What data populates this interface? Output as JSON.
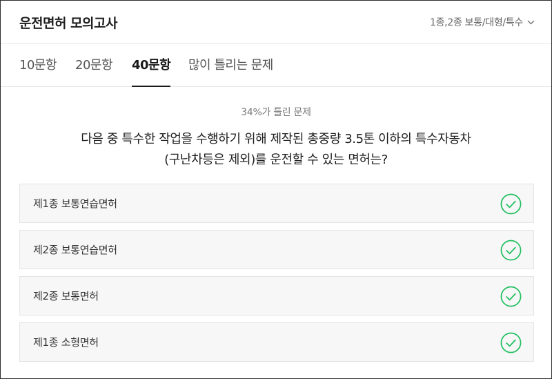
{
  "header": {
    "title": "운전면허 모의고사",
    "license_type": "1종,2종 보통/대형/특수"
  },
  "tabs": [
    {
      "label": "10문항",
      "active": false
    },
    {
      "label": "20문항",
      "active": false
    },
    {
      "label": "40문항",
      "active": true
    },
    {
      "label": "많이 틀리는 문제",
      "active": false
    }
  ],
  "question": {
    "stat": "34%가 틀린 문제",
    "line1": "다음 중 특수한 작업을 수행하기 위해 제작된 총중량 3.5톤 이하의 특수자동차",
    "line2": "(구난차등은 제외)를 운전할 수 있는 면허는?"
  },
  "options": [
    {
      "label": "제1종 보통연습면허",
      "icon": "check-circle-icon"
    },
    {
      "label": "제2종 보통연습면허",
      "icon": "check-circle-icon"
    },
    {
      "label": "제2종 보통면허",
      "icon": "check-circle-icon"
    },
    {
      "label": "제1종 소형면허",
      "icon": "check-circle-icon"
    }
  ],
  "colors": {
    "check": "#1fbf5f",
    "option_bg": "#f7f7f7",
    "border": "#e3e3e3"
  }
}
